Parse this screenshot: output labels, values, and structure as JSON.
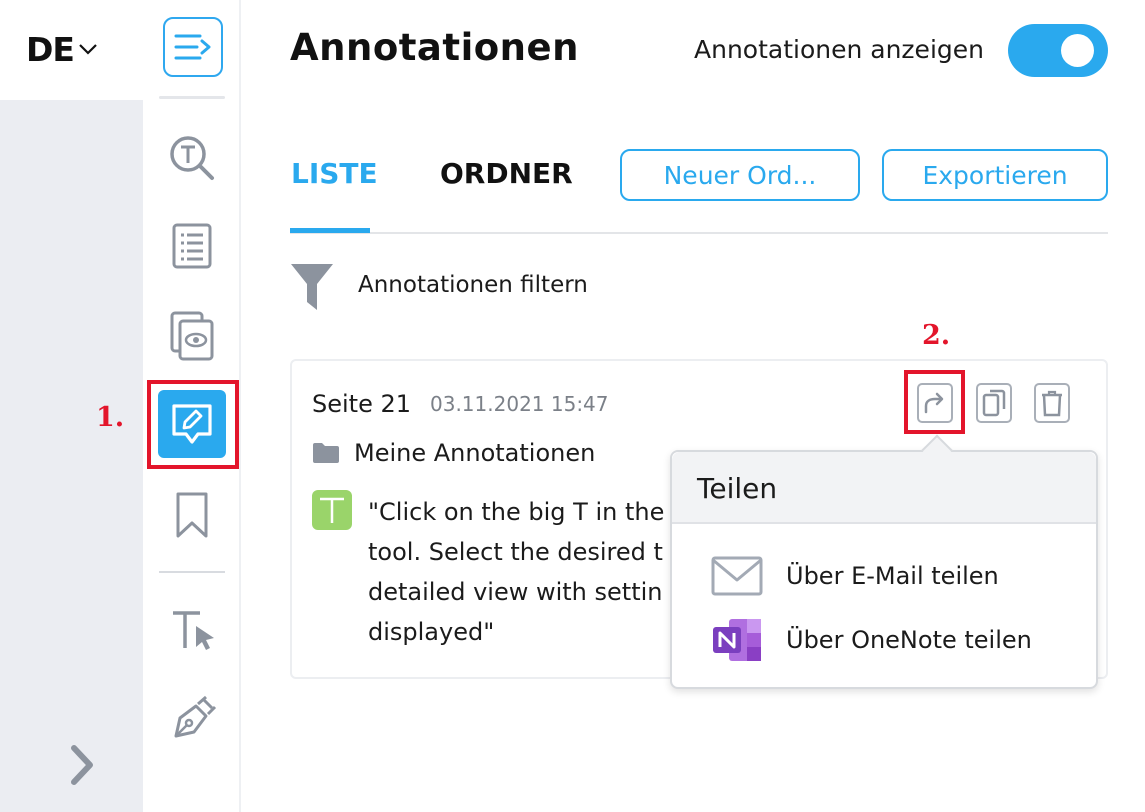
{
  "language": {
    "label": "DE"
  },
  "header": {
    "title": "Annotationen",
    "toggle_label": "Annotationen anzeigen",
    "toggle_on": true
  },
  "tabs": [
    {
      "label": "LISTE",
      "active": true
    },
    {
      "label": "ORDNER",
      "active": false
    }
  ],
  "buttons": {
    "new_folder": "Neuer Ord...",
    "export": "Exportieren"
  },
  "filter": {
    "label": "Annotationen filtern"
  },
  "annotation": {
    "page": "Seite 21",
    "date": "03.11.2021 15:47",
    "folder": "Meine Annotationen",
    "type_badge": "T",
    "comment_lines": [
      "\"Click on the big T in the",
      "tool. Select the desired t",
      "detailed view with settin",
      "displayed\""
    ]
  },
  "share_popup": {
    "title": "Teilen",
    "items": [
      {
        "label": "Über E-Mail teilen",
        "icon": "mail-icon"
      },
      {
        "label": "Über OneNote teilen",
        "icon": "onenote-icon"
      }
    ]
  },
  "markers": {
    "step1": "1.",
    "step2": "2."
  },
  "colors": {
    "accent": "#2aa9ee",
    "highlight": "#e3152b",
    "badge": "#9ad46a",
    "onenote": "#7b3fbf"
  }
}
